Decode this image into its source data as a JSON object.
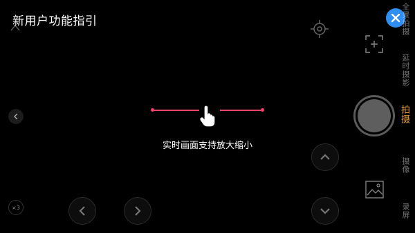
{
  "guide": {
    "title": "新用户功能指引",
    "hint": "实时画面支持放大缩小"
  },
  "modes": {
    "item1": "延时摄影",
    "item2": "全景拍摄",
    "capture": "拍摄",
    "video": "摄像",
    "screen_record": "录屏"
  },
  "zoom": {
    "label": "×3"
  },
  "colors": {
    "accent_blue": "#2f8ff0",
    "active_mode": "#e8a13a",
    "pinch_line": "#e8456a"
  },
  "icons": {
    "close": "close-icon",
    "focus": "focus-target-icon",
    "frame": "frame-add-icon",
    "gallery": "gallery-icon",
    "hand": "hand-pointer-icon"
  }
}
